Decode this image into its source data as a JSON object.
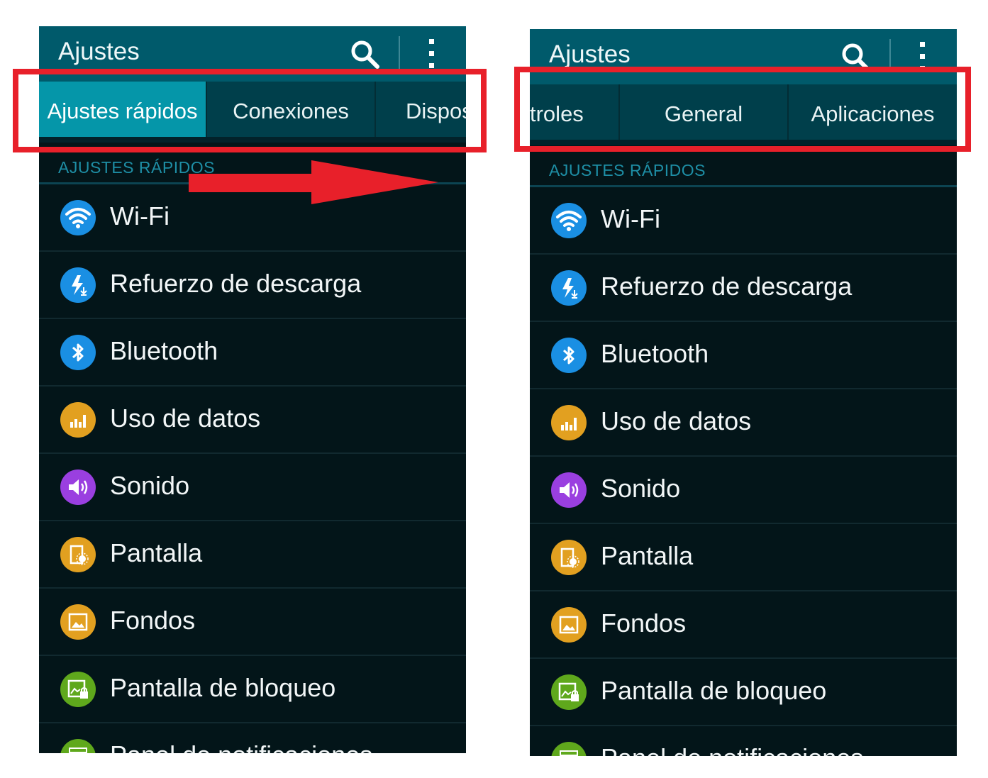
{
  "left_screen": {
    "title": "Ajustes",
    "tabs": [
      {
        "label": "Ajustes rápidos"
      },
      {
        "label": "Conexiones"
      },
      {
        "label": "Dispos"
      }
    ],
    "section_header": "AJUSTES RÁPIDOS",
    "items": [
      {
        "label": "Wi-Fi",
        "icon": "wifi-icon",
        "color": "#1a8fe3"
      },
      {
        "label": "Refuerzo de descarga",
        "icon": "download-booster-icon",
        "color": "#1a8fe3"
      },
      {
        "label": "Bluetooth",
        "icon": "bluetooth-icon",
        "color": "#1a8fe3"
      },
      {
        "label": "Uso de datos",
        "icon": "data-usage-icon",
        "color": "#e2a020"
      },
      {
        "label": "Sonido",
        "icon": "sound-icon",
        "color": "#9a3fe0"
      },
      {
        "label": "Pantalla",
        "icon": "display-icon",
        "color": "#e2a020"
      },
      {
        "label": "Fondos",
        "icon": "wallpaper-icon",
        "color": "#e2a020"
      },
      {
        "label": "Pantalla de bloqueo",
        "icon": "lock-screen-icon",
        "color": "#5fa81c"
      },
      {
        "label": "Panel de notificaciones",
        "icon": "notification-panel-icon",
        "color": "#5fa81c"
      }
    ]
  },
  "right_screen": {
    "title": "Ajustes",
    "tabs": [
      {
        "label": "troles"
      },
      {
        "label": "General"
      },
      {
        "label": "Aplicaciones"
      }
    ],
    "section_header": "AJUSTES RÁPIDOS",
    "items": [
      {
        "label": "Wi-Fi",
        "icon": "wifi-icon",
        "color": "#1a8fe3"
      },
      {
        "label": "Refuerzo de descarga",
        "icon": "download-booster-icon",
        "color": "#1a8fe3"
      },
      {
        "label": "Bluetooth",
        "icon": "bluetooth-icon",
        "color": "#1a8fe3"
      },
      {
        "label": "Uso de datos",
        "icon": "data-usage-icon",
        "color": "#e2a020"
      },
      {
        "label": "Sonido",
        "icon": "sound-icon",
        "color": "#9a3fe0"
      },
      {
        "label": "Pantalla",
        "icon": "display-icon",
        "color": "#e2a020"
      },
      {
        "label": "Fondos",
        "icon": "wallpaper-icon",
        "color": "#e2a020"
      },
      {
        "label": "Pantalla de bloqueo",
        "icon": "lock-screen-icon",
        "color": "#5fa81c"
      },
      {
        "label": "Panel de notificaciones",
        "icon": "notification-panel-icon",
        "color": "#5fa81c"
      }
    ]
  },
  "colors": {
    "action_bar": "#005a6b",
    "tab_bar": "#003f4b",
    "active_tab": "#0596a9",
    "background": "#031519",
    "annotation": "#e8202a"
  }
}
